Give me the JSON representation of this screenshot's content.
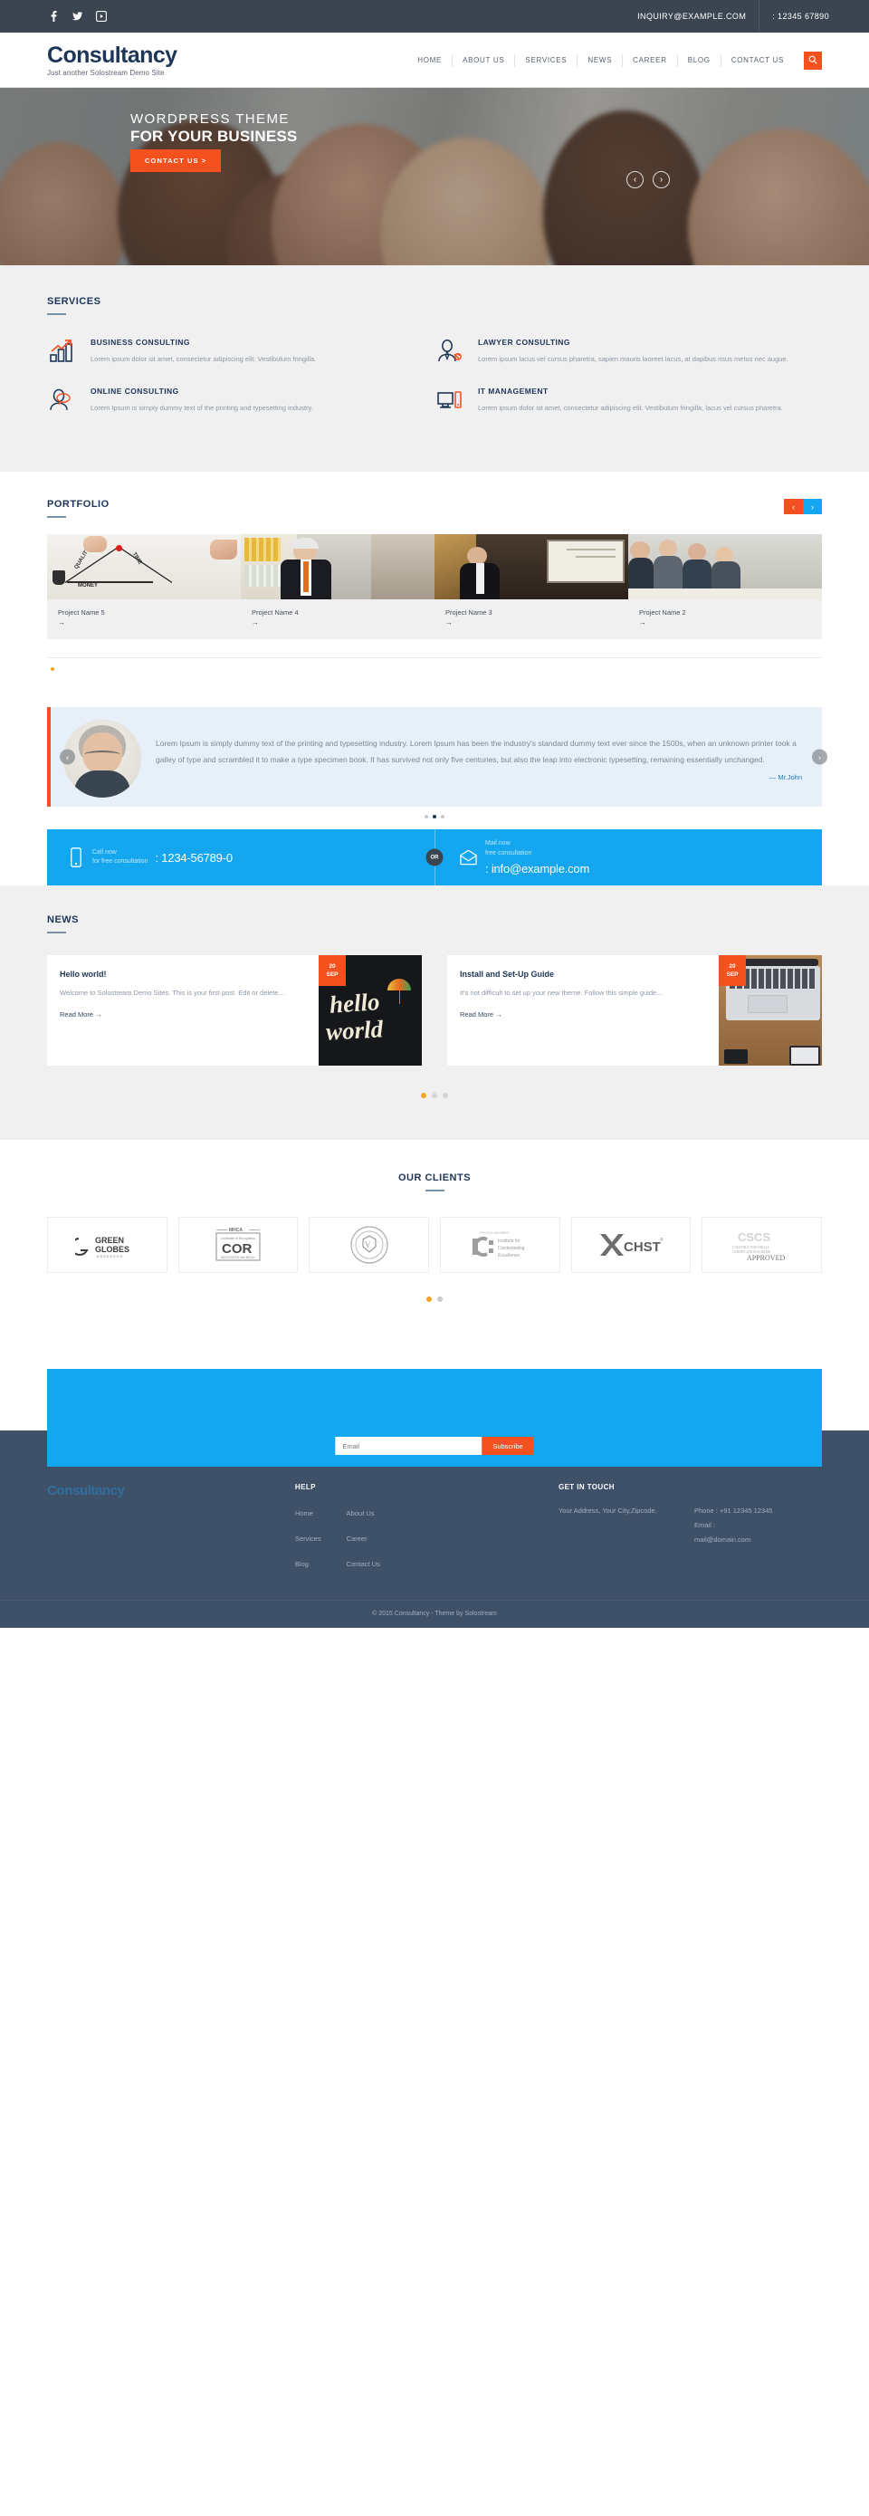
{
  "topbar": {
    "social": [
      {
        "name": "facebook-icon",
        "glyph": "f"
      },
      {
        "name": "twitter-icon",
        "glyph": "ᴠ"
      },
      {
        "name": "video-icon",
        "glyph": "▶"
      }
    ],
    "email": "INQUIRY@EXAMPLE.COM",
    "phone": ": 12345 67890"
  },
  "header": {
    "logo": "Consultancy",
    "tagline": "Just another Solostream Demo Site",
    "nav": [
      "HOME",
      "ABOUT US",
      "SERVICES",
      "NEWS",
      "CAREER",
      "BLOG",
      "CONTACT US"
    ],
    "search_icon": "search-icon"
  },
  "hero": {
    "line1": "WORDPRESS THEME",
    "line2": "FOR YOUR BUSINESS",
    "cta": "CONTACT US >",
    "prev": "‹",
    "next": "›"
  },
  "services": {
    "title": "SERVICES",
    "items": [
      {
        "icon": "bar-chart-growth-icon",
        "title": "BUSINESS CONSULTING",
        "text": "Lorem ipsum dolor sit amet, consectetur adipiscing elit. Vestibulum fringilla."
      },
      {
        "icon": "lawyer-person-icon",
        "title": "LAWYER CONSULTING",
        "text": "Lorem ipsum lacus vel cursus pharetra, sapien mauris laoreet lacus, at dapibus risus metus nec augue."
      },
      {
        "icon": "person-chat-icon",
        "title": "ONLINE CONSULTING",
        "text": "Lorem Ipsum is simply dummy text of the printing and typesetting industry."
      },
      {
        "icon": "monitor-device-icon",
        "title": "IT MANAGEMENT",
        "text": "Lorem ipsum dolor sit amet, consectetur adipiscing elit. Vestibulum fringilla, lacus vel cursus pharetra."
      }
    ]
  },
  "portfolio": {
    "title": "PORTFOLIO",
    "prev": "‹",
    "next": "›",
    "items": [
      {
        "name": "Project Name 5",
        "arrow": "→"
      },
      {
        "name": "Project Name 4",
        "arrow": "→"
      },
      {
        "name": "Project Name 3",
        "arrow": "→"
      },
      {
        "name": "Project Name 2",
        "arrow": "→"
      }
    ]
  },
  "testimonial": {
    "quote": "Lorem Ipsum is simply dummy text of the printing and typesetting industry. Lorem Ipsum has been the industry's standard dummy text ever since the 1500s, when an unknown printer took a galley of type and scrambled it to make a type specimen book. It has survived not only five centuries, but also the leap into electronic typesetting, remaining essentially unchanged.",
    "author": "— Mr.John",
    "prev": "‹",
    "next": "›",
    "dots_total": 3,
    "dots_active": 1
  },
  "contact_strip": {
    "call_label_1": "Call now",
    "call_label_2": "for free consultation",
    "phone": ": 1234-56789-0",
    "or": "OR",
    "mail_label_1": "Mail now",
    "mail_label_2": "free consultation",
    "email": ": info@example.com",
    "phone_icon": "mobile-phone-icon",
    "mail_icon": "envelope-icon"
  },
  "news": {
    "title": "NEWS",
    "posts": [
      {
        "title": "Hello world!",
        "excerpt": "Welcome to Solostream Demo Sites. This is your first post. Edit or delete…",
        "readmore": "Read More →",
        "day": "20",
        "month": "SEP",
        "thumb": "hello-world-lettering-image"
      },
      {
        "title": "Install and Set-Up Guide",
        "excerpt": "It's not difficult to set up your new theme. Follow this simple guide…",
        "readmore": "Read More →",
        "day": "20",
        "month": "SEP",
        "thumb": "laptop-desk-image"
      }
    ],
    "dots_total": 3,
    "dots_active": 0
  },
  "clients": {
    "title": "OUR CLIENTS",
    "logos": [
      {
        "name": "green-globes-logo",
        "line1": "GREEN",
        "line2": "GLOBES",
        "line3": "ASSESSOR"
      },
      {
        "name": "cor-mhca-logo",
        "line1": "MHCA",
        "line2": "COR",
        "line3": "Certificate of Recognition"
      },
      {
        "name": "seal-emblem-logo",
        "line1": "",
        "line2": "",
        "line3": ""
      },
      {
        "name": "institute-credentialing-excellence-logo",
        "line1": "PROUD MEMBER",
        "line2": "Institute for Credentialing Excellence",
        "line3": ""
      },
      {
        "name": "chst-logo",
        "line1": "CHST",
        "line2": "",
        "line3": ""
      },
      {
        "name": "cscs-approved-logo",
        "line1": "CSCS",
        "line2": "CONSTRUCTION SKILLS CERTIFICATION SCHEME",
        "line3": "APPROVED"
      }
    ],
    "dots_total": 2,
    "dots_active": 0
  },
  "newsletter": {
    "placeholder": "Email",
    "value": "",
    "button": "Subscribe"
  },
  "footer": {
    "logo": "Consultancy",
    "help_title": "HELP",
    "help_col1": [
      "Home",
      "Services",
      "Blog"
    ],
    "help_col2": [
      "About Us",
      "Career",
      "Contact Us"
    ],
    "touch_title": "GET IN TOUCH",
    "address": "Your Address, Your City,Zipcode.",
    "phone": "Phone : +91 12345 12345",
    "email_label": "Email :",
    "email": "mail@domain.com",
    "copyright": "© 2015 Consultancy - Theme by Solostream"
  },
  "colors": {
    "accent_orange": "#f4511e",
    "accent_blue": "#14a7ef",
    "navy": "#1d3557",
    "dark_bar": "#3b4552",
    "footer": "#3f5069",
    "amber": "#f4a421"
  }
}
